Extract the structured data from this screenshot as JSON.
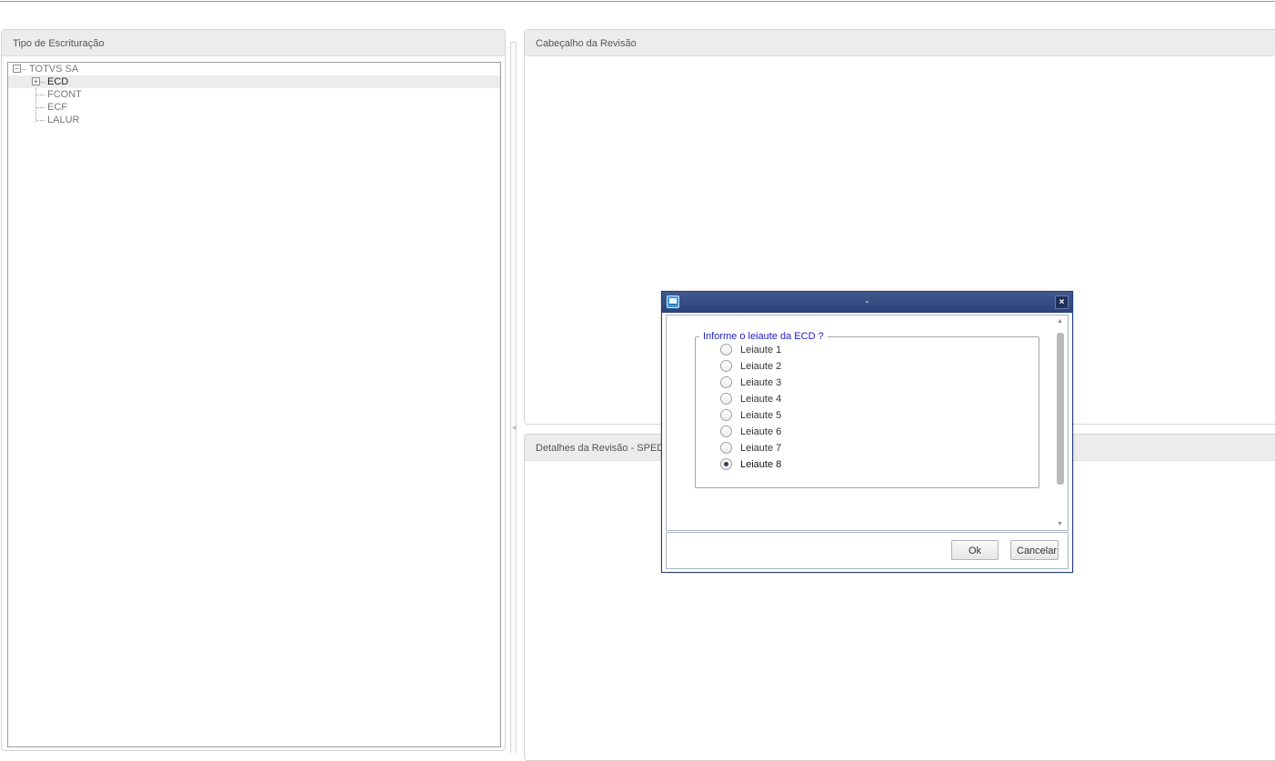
{
  "panels": {
    "left_title": "Tipo de Escrituração",
    "header_title": "Cabeçalho da Revisão",
    "details_title": "Detalhes da Revisão - SPED"
  },
  "tree": {
    "root": "TOTVS SA",
    "items": [
      "ECD",
      "FCONT",
      "ECF",
      "LALUR"
    ],
    "selected": "ECD"
  },
  "dialog": {
    "title": "-",
    "close_label": "×",
    "group_label": "Informe o leiaute da ECD  ?",
    "options": [
      "Leiaute 1",
      "Leiaute 2",
      "Leiaute 3",
      "Leiaute 4",
      "Leiaute 5",
      "Leiaute 6",
      "Leiaute 7",
      "Leiaute 8"
    ],
    "selected_option": "Leiaute 8",
    "ok_label": "Ok",
    "cancel_label": "Cancelar"
  }
}
